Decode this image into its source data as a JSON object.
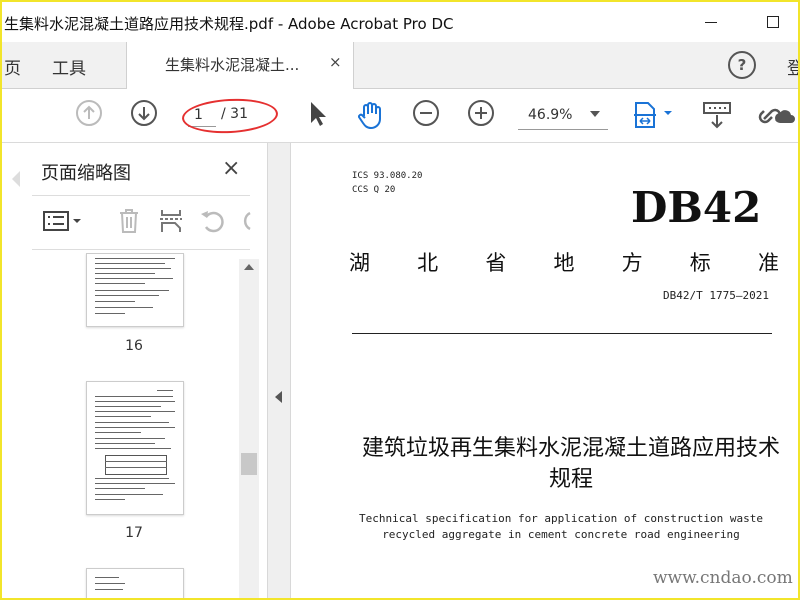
{
  "window": {
    "title": "生集料水泥混凝土道路应用技术规程.pdf - Adobe Acrobat Pro DC"
  },
  "tabs": {
    "home": "页",
    "tools": "工具",
    "document": "生集料水泥混凝土...",
    "close": "×",
    "help": "?",
    "extra": "登"
  },
  "toolbar": {
    "page_current": "1",
    "page_total": "/ 31",
    "zoom": "46.9%"
  },
  "thumbnails": {
    "title": "页面缩略图",
    "close": "×",
    "pages": [
      {
        "number": "16"
      },
      {
        "number": "17"
      }
    ]
  },
  "document": {
    "ics": "ICS  93.080.20",
    "ccs": "CCS  Q 20",
    "code": "DB42",
    "standard_chars": [
      "湖",
      "北",
      "省",
      "地",
      "方",
      "标",
      "准"
    ],
    "number": "DB42/T 1775—2021",
    "title": "建筑垃圾再生集料水泥混凝土道路应用技术规程",
    "subtitle_en": "Technical specification for application of construction waste recycled aggregate in cement concrete road engineering",
    "watermark": "www.cndao.com"
  },
  "colors": {
    "frame_border": "#f2e52b",
    "annotation_oval": "#e53030",
    "accent_blue": "#1a73d6"
  }
}
